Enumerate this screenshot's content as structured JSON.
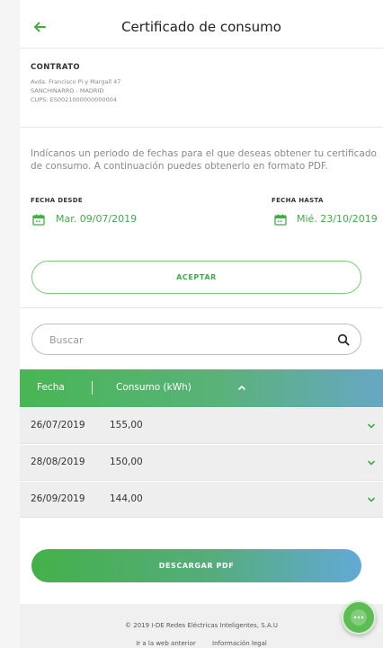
{
  "header": {
    "title": "Certificado de consumo"
  },
  "contract": {
    "title": "CONTRATO",
    "address": "Avda. Francisco Pi y Margall 47",
    "city": "SANCHINARRO - MADRID",
    "cups": "CUPS: ES0021000000000004"
  },
  "intro": "Indícanos un periodo de fechas para el que deseas obtener tu certificado de consumo. A continuación puedes obtenerlo en formato PDF.",
  "dates": {
    "from_label": "FECHA DESDE",
    "from_value": "Mar. 09/07/2019",
    "to_label": "FECHA HASTA",
    "to_value": "Mié. 23/10/2019"
  },
  "accept_label": "ACEPTAR",
  "search": {
    "placeholder": "Buscar",
    "value": ""
  },
  "table": {
    "columns": [
      "Fecha",
      "Consumo (kWh)"
    ],
    "rows": [
      {
        "date": "26/07/2019",
        "value": "155,00"
      },
      {
        "date": "28/08/2019",
        "value": "150,00"
      },
      {
        "date": "26/09/2019",
        "value": "144,00"
      }
    ]
  },
  "download_label": "DESCARGAR PDF",
  "footer": {
    "copyright": "© 2019 I-DE Redes Eléctricas Inteligentes, S.A.U",
    "links": [
      "Ir a la web anterior",
      "Información legal"
    ]
  },
  "colors": {
    "accent": "#3fae49",
    "header_gradient_start": "#47b654",
    "header_gradient_end": "#66a7c4"
  },
  "icons": {
    "back": "arrow-left-icon",
    "calendar": "calendar-icon",
    "search": "search-icon",
    "sort": "chevron-up-icon",
    "expand": "chevron-down-icon",
    "chat": "chat-icon"
  }
}
